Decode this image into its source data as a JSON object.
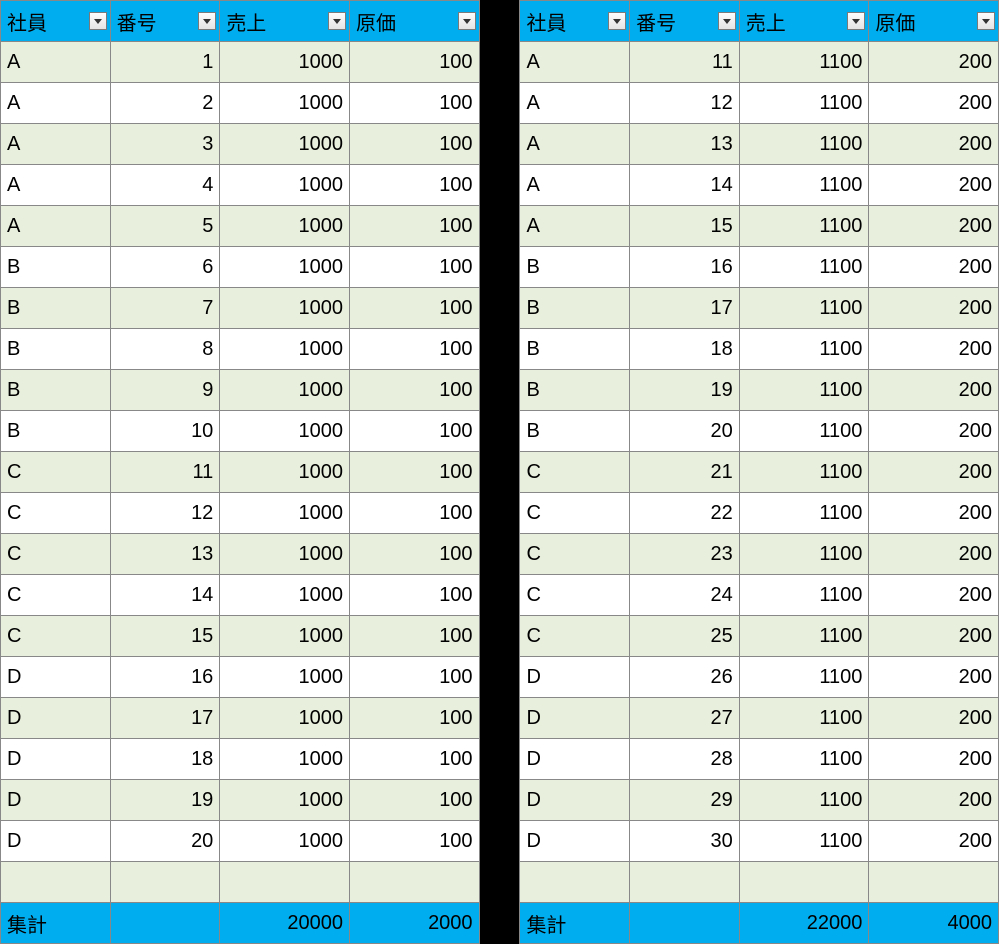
{
  "headers": {
    "employee": "社員",
    "number": "番号",
    "sales": "売上",
    "cost": "原価"
  },
  "totalLabel": "集計",
  "tables": [
    {
      "rows": [
        {
          "employee": "A",
          "number": 1,
          "sales": 1000,
          "cost": 100
        },
        {
          "employee": "A",
          "number": 2,
          "sales": 1000,
          "cost": 100
        },
        {
          "employee": "A",
          "number": 3,
          "sales": 1000,
          "cost": 100
        },
        {
          "employee": "A",
          "number": 4,
          "sales": 1000,
          "cost": 100
        },
        {
          "employee": "A",
          "number": 5,
          "sales": 1000,
          "cost": 100
        },
        {
          "employee": "B",
          "number": 6,
          "sales": 1000,
          "cost": 100
        },
        {
          "employee": "B",
          "number": 7,
          "sales": 1000,
          "cost": 100
        },
        {
          "employee": "B",
          "number": 8,
          "sales": 1000,
          "cost": 100
        },
        {
          "employee": "B",
          "number": 9,
          "sales": 1000,
          "cost": 100
        },
        {
          "employee": "B",
          "number": 10,
          "sales": 1000,
          "cost": 100
        },
        {
          "employee": "C",
          "number": 11,
          "sales": 1000,
          "cost": 100
        },
        {
          "employee": "C",
          "number": 12,
          "sales": 1000,
          "cost": 100
        },
        {
          "employee": "C",
          "number": 13,
          "sales": 1000,
          "cost": 100
        },
        {
          "employee": "C",
          "number": 14,
          "sales": 1000,
          "cost": 100
        },
        {
          "employee": "C",
          "number": 15,
          "sales": 1000,
          "cost": 100
        },
        {
          "employee": "D",
          "number": 16,
          "sales": 1000,
          "cost": 100
        },
        {
          "employee": "D",
          "number": 17,
          "sales": 1000,
          "cost": 100
        },
        {
          "employee": "D",
          "number": 18,
          "sales": 1000,
          "cost": 100
        },
        {
          "employee": "D",
          "number": 19,
          "sales": 1000,
          "cost": 100
        },
        {
          "employee": "D",
          "number": 20,
          "sales": 1000,
          "cost": 100
        }
      ],
      "totals": {
        "sales": 20000,
        "cost": 2000
      }
    },
    {
      "rows": [
        {
          "employee": "A",
          "number": 11,
          "sales": 1100,
          "cost": 200
        },
        {
          "employee": "A",
          "number": 12,
          "sales": 1100,
          "cost": 200
        },
        {
          "employee": "A",
          "number": 13,
          "sales": 1100,
          "cost": 200
        },
        {
          "employee": "A",
          "number": 14,
          "sales": 1100,
          "cost": 200
        },
        {
          "employee": "A",
          "number": 15,
          "sales": 1100,
          "cost": 200
        },
        {
          "employee": "B",
          "number": 16,
          "sales": 1100,
          "cost": 200
        },
        {
          "employee": "B",
          "number": 17,
          "sales": 1100,
          "cost": 200
        },
        {
          "employee": "B",
          "number": 18,
          "sales": 1100,
          "cost": 200
        },
        {
          "employee": "B",
          "number": 19,
          "sales": 1100,
          "cost": 200
        },
        {
          "employee": "B",
          "number": 20,
          "sales": 1100,
          "cost": 200
        },
        {
          "employee": "C",
          "number": 21,
          "sales": 1100,
          "cost": 200
        },
        {
          "employee": "C",
          "number": 22,
          "sales": 1100,
          "cost": 200
        },
        {
          "employee": "C",
          "number": 23,
          "sales": 1100,
          "cost": 200
        },
        {
          "employee": "C",
          "number": 24,
          "sales": 1100,
          "cost": 200
        },
        {
          "employee": "C",
          "number": 25,
          "sales": 1100,
          "cost": 200
        },
        {
          "employee": "D",
          "number": 26,
          "sales": 1100,
          "cost": 200
        },
        {
          "employee": "D",
          "number": 27,
          "sales": 1100,
          "cost": 200
        },
        {
          "employee": "D",
          "number": 28,
          "sales": 1100,
          "cost": 200
        },
        {
          "employee": "D",
          "number": 29,
          "sales": 1100,
          "cost": 200
        },
        {
          "employee": "D",
          "number": 30,
          "sales": 1100,
          "cost": 200
        }
      ],
      "totals": {
        "sales": 22000,
        "cost": 4000
      }
    }
  ]
}
